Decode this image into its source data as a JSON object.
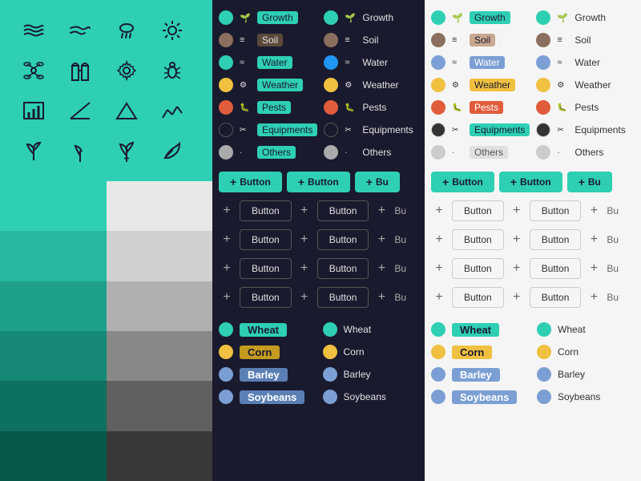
{
  "colors": {
    "teal": "#2ecfb3",
    "dark_bg": "#1a1a2e",
    "light_bg": "#f5f5f5",
    "white": "#ffffff",
    "gray1": "#e8e8e8",
    "gray2": "#d0d0d0",
    "gray3": "#b0b0b0",
    "gray4": "#888888",
    "gray5": "#606060",
    "gray6": "#383838"
  },
  "categories": [
    {
      "label": "Growth",
      "color": "#2ecfb3",
      "icon": "🌱"
    },
    {
      "label": "Soil",
      "color": "#8B6F5E",
      "icon": "≡"
    },
    {
      "label": "Water",
      "color": "#2ecfb3",
      "icon": "≈"
    },
    {
      "label": "Weather",
      "color": "#f0c040",
      "icon": "⚙"
    },
    {
      "label": "Pests",
      "color": "#e05c3a",
      "icon": "🐛"
    },
    {
      "label": "Equipments",
      "color": "#1a1a2e",
      "icon": "✂"
    },
    {
      "label": "Others",
      "color": "#cccccc",
      "icon": "·"
    }
  ],
  "buttons": {
    "filled_label": "Button",
    "outline_label": "Button",
    "plus": "+"
  },
  "crops": [
    {
      "label": "Wheat",
      "color": "#2ecfb3"
    },
    {
      "label": "Corn",
      "color": "#f0c040"
    },
    {
      "label": "Barley",
      "color": "#7B9FD4"
    },
    {
      "label": "Soybeans",
      "color": "#7B9FD4"
    }
  ]
}
